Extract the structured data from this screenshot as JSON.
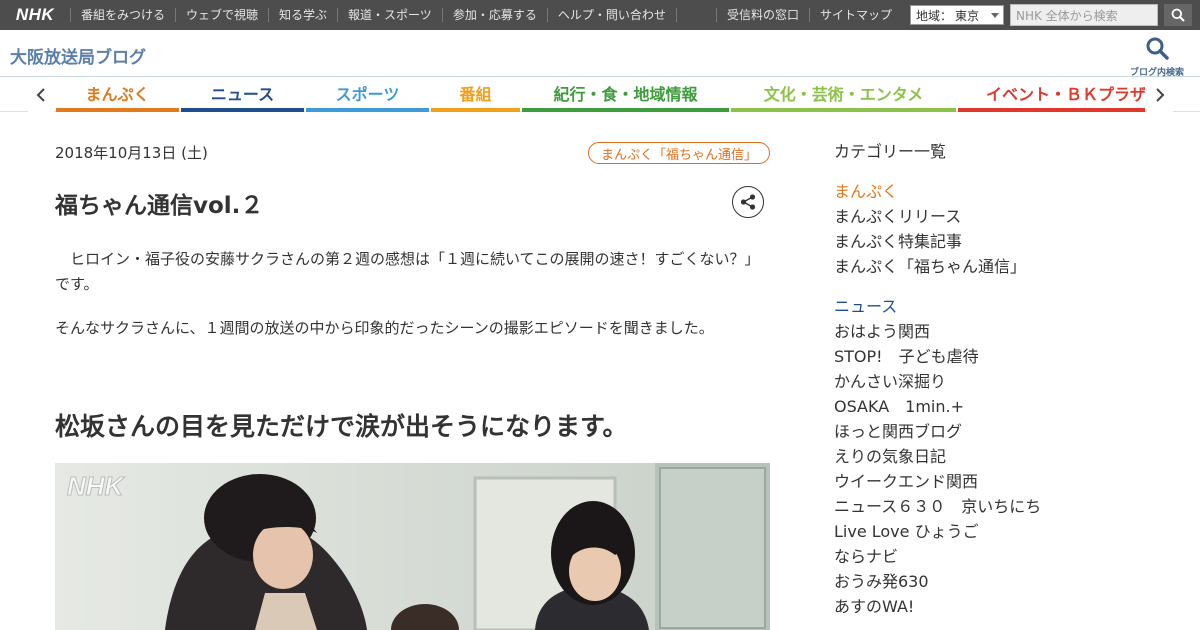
{
  "global_nav": {
    "logo": "NHK",
    "items": [
      "番組をみつける",
      "ウェブで視聴",
      "知る学ぶ",
      "報道・スポーツ",
      "参加・応募する",
      "ヘルプ・問い合わせ"
    ],
    "right_items": [
      "受信料の窓口",
      "サイトマップ"
    ],
    "region_label": "地域：",
    "region_value": "東京",
    "search_placeholder": "NHK 全体から検索"
  },
  "blog": {
    "title": "大阪放送局ブログ",
    "search_label": "ブログ内検索"
  },
  "category_nav": {
    "tabs": [
      {
        "label": "まんぷく",
        "color": "#e07a1c"
      },
      {
        "label": "ニュース",
        "color": "#1f4e8f"
      },
      {
        "label": "スポーツ",
        "color": "#3f9ad8"
      },
      {
        "label": "番組",
        "color": "#f0a01a"
      },
      {
        "label": "紀行・食・地域情報",
        "color": "#3f9c3c"
      },
      {
        "label": "文化・芸術・エンタメ",
        "color": "#8dc24a"
      },
      {
        "label": "イベント・ＢＫプラザ",
        "color": "#e0392b"
      }
    ]
  },
  "article": {
    "date": "2018年10月13日 (土)",
    "tag": "まんぷく「福ちゃん通信」",
    "title": "福ちゃん通信vol.２",
    "paragraph1": "　ヒロイン・福子役の安藤サクラさんの第２週の感想は「１週に続いてこの展開の速さ！すごくない？」です。",
    "paragraph2": "そんなサクラさんに、１週間の放送の中から印象的だったシーンの撮影エピソードを聞きました。",
    "heading2": "松坂さんの目を見ただけで涙が出そうになります。",
    "photo_watermark": "NHK"
  },
  "sidebar": {
    "heading": "カテゴリー一覧",
    "groups": [
      {
        "title": "まんぷく",
        "color": "#e07a1c",
        "items": [
          "まんぷくリリース",
          "まんぷく特集記事",
          "まんぷく「福ちゃん通信」"
        ]
      },
      {
        "title": "ニュース",
        "color": "#1f4e8f",
        "items": [
          "おはよう関西",
          "STOP!　子ども虐待",
          "かんさい深掘り",
          "OSAKA　1min.+",
          "ほっと関西ブログ",
          "えりの気象日記",
          "ウイークエンド関西",
          "ニュース６３０　京いちにち",
          "Live Love ひょうご",
          "ならナビ",
          "おうみ発630",
          "あすのWA!"
        ]
      }
    ]
  }
}
